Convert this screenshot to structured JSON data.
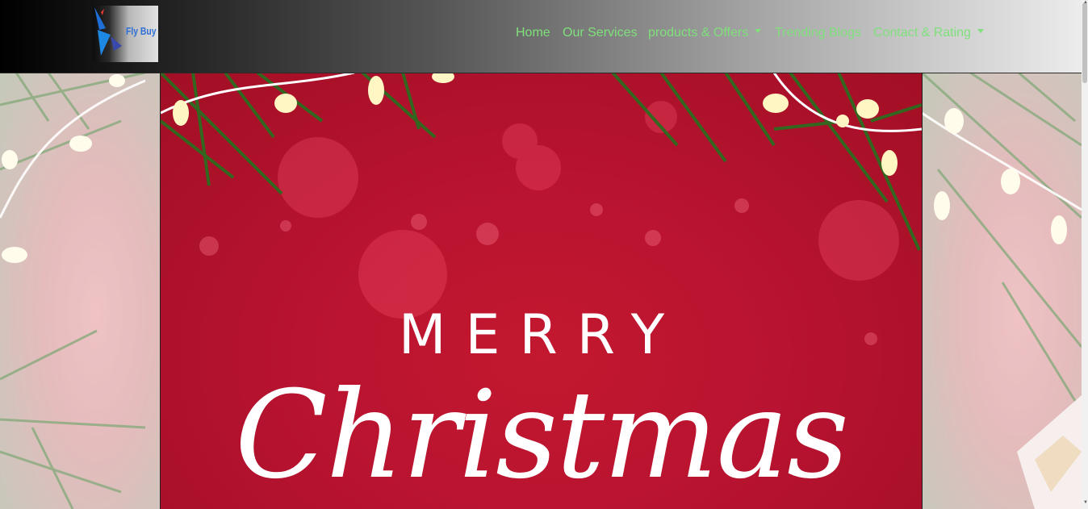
{
  "brand": {
    "name": "Fly Buy",
    "icon": "bird-logo-icon"
  },
  "nav": {
    "items": [
      {
        "label": "Home",
        "dropdown": false
      },
      {
        "label": "Our Services",
        "dropdown": false
      },
      {
        "label": "products & Offers",
        "dropdown": true
      },
      {
        "label": "Trending Blogs",
        "dropdown": false
      },
      {
        "label": "Contact & Rating",
        "dropdown": true
      }
    ],
    "link_color": "#7fe07c"
  },
  "hero": {
    "line1": "MERRY",
    "line2": "Christmas",
    "accent": "#b81330"
  }
}
